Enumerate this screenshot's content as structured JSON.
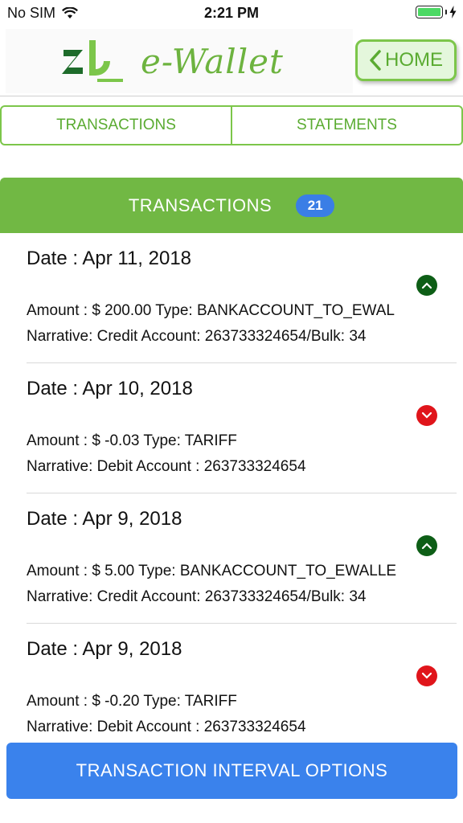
{
  "status_bar": {
    "carrier": "No SIM",
    "time": "2:21 PM"
  },
  "header": {
    "logo_text": "e-Wallet",
    "home_label": "HOME"
  },
  "tabs": [
    {
      "label": "TRANSACTIONS"
    },
    {
      "label": "STATEMENTS"
    }
  ],
  "transactions_panel": {
    "title": "TRANSACTIONS",
    "count": "21"
  },
  "transactions": [
    {
      "date": "Date : Apr 11, 2018",
      "direction": "up",
      "amount_line": "Amount : $ 200.00 Type: BANKACCOUNT_TO_EWAL",
      "narrative_line": "Narrative: Credit Account: 263733324654/Bulk: 34"
    },
    {
      "date": "Date : Apr 10, 2018",
      "direction": "down",
      "amount_line": "Amount : $ -0.03 Type: TARIFF",
      "narrative_line": "Narrative: Debit Account : 263733324654"
    },
    {
      "date": "Date : Apr 9, 2018",
      "direction": "up",
      "amount_line": "Amount : $ 5.00 Type: BANKACCOUNT_TO_EWALLE",
      "narrative_line": "Narrative: Credit Account: 263733324654/Bulk: 34"
    },
    {
      "date": "Date : Apr 9, 2018",
      "direction": "down",
      "amount_line": "Amount : $ -0.20 Type: TARIFF",
      "narrative_line": "Narrative: Debit Account : 263733324654"
    }
  ],
  "bottom_button": {
    "label": "TRANSACTION INTERVAL OPTIONS"
  },
  "colors": {
    "green": "#71b844",
    "blue": "#3a82ec",
    "credit": "#0d5e16",
    "debit": "#e0151b"
  }
}
